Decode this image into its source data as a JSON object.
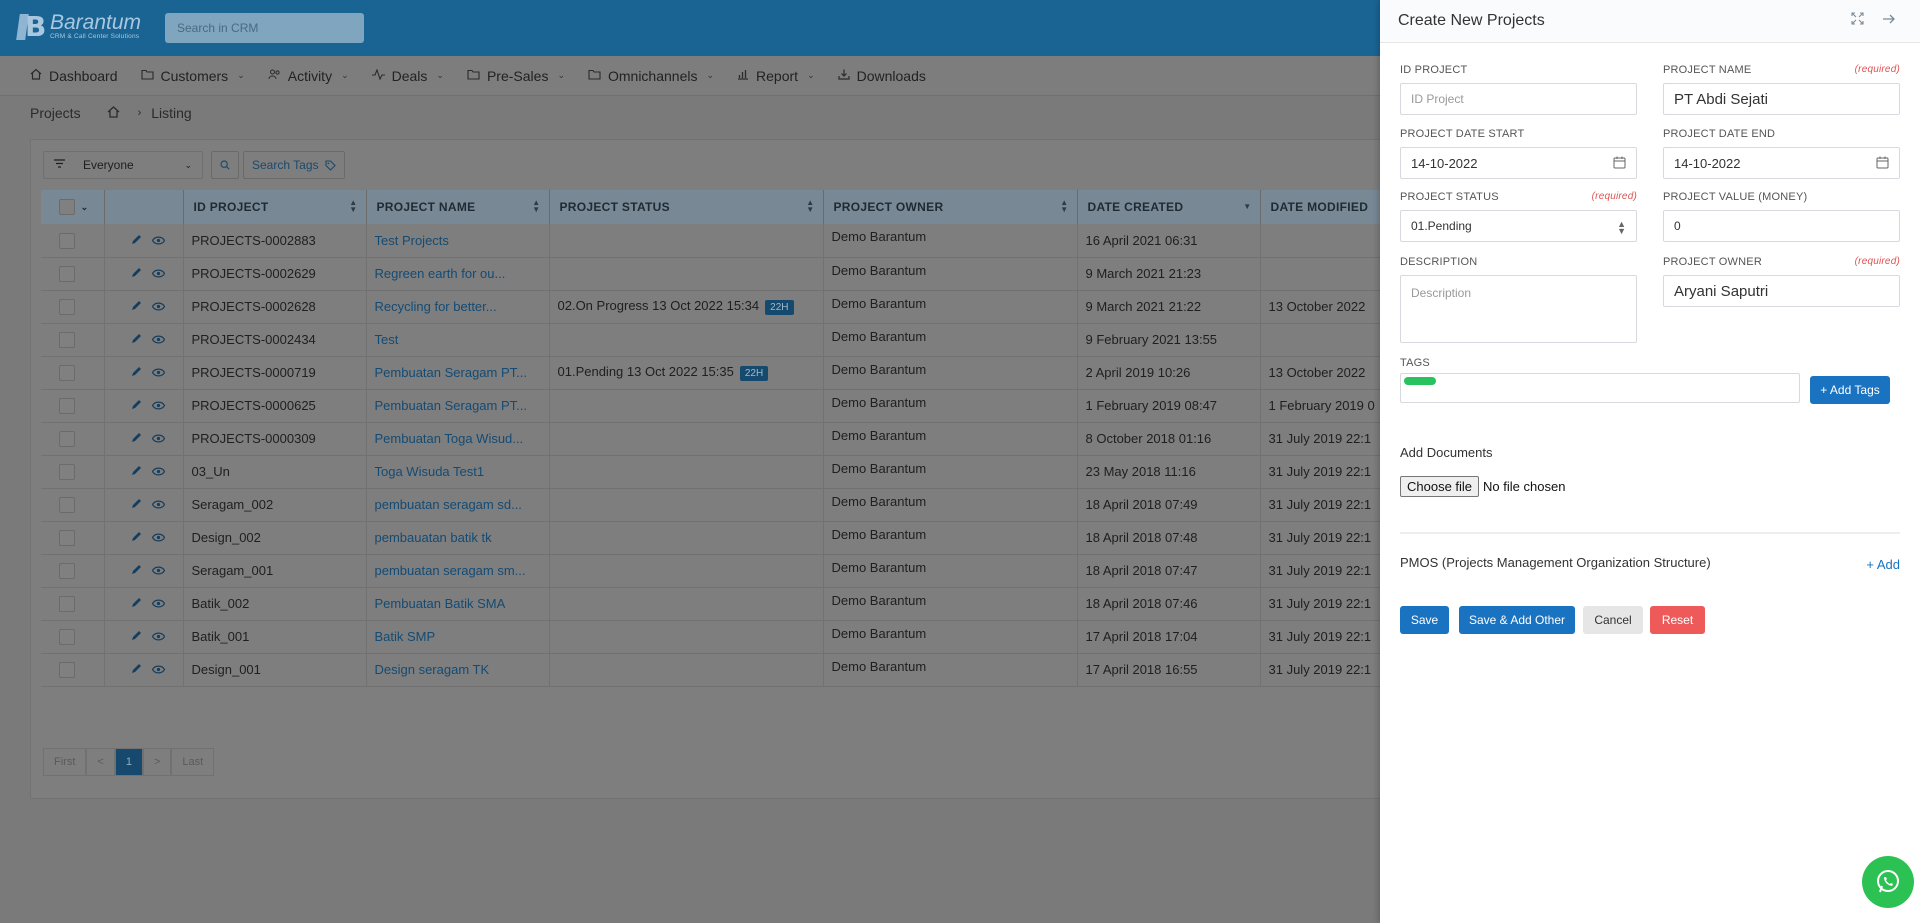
{
  "app": {
    "logo_name": "Barantum",
    "logo_sub": "CRM & Call Center Solutions",
    "search_placeholder": "Search in CRM"
  },
  "nav": [
    {
      "label": "Dashboard",
      "icon": "home-icon",
      "has_dropdown": false
    },
    {
      "label": "Customers",
      "icon": "folder-icon",
      "has_dropdown": true
    },
    {
      "label": "Activity",
      "icon": "people-icon",
      "has_dropdown": true
    },
    {
      "label": "Deals",
      "icon": "pulse-icon",
      "has_dropdown": true
    },
    {
      "label": "Pre-Sales",
      "icon": "folder-icon",
      "has_dropdown": true
    },
    {
      "label": "Omnichannels",
      "icon": "folder-icon",
      "has_dropdown": true
    },
    {
      "label": "Report",
      "icon": "bar-chart-icon",
      "has_dropdown": true
    },
    {
      "label": "Downloads",
      "icon": "download-icon",
      "has_dropdown": false
    }
  ],
  "breadcrumb": {
    "section": "Projects",
    "page": "Listing"
  },
  "filter": {
    "owner_select": "Everyone",
    "search_tags_label": "Search Tags"
  },
  "table": {
    "columns": [
      "ID PROJECT",
      "PROJECT NAME",
      "PROJECT STATUS",
      "PROJECT OWNER",
      "DATE CREATED",
      "DATE MODIFIED"
    ],
    "rows": [
      {
        "id": "PROJECTS-0002883",
        "name": "Test Projects",
        "status": "",
        "badge": "",
        "owner": "Demo Barantum",
        "created": "16 April 2021 06:31",
        "modified": ""
      },
      {
        "id": "PROJECTS-0002629",
        "name": "Regreen earth for ou...",
        "status": "",
        "badge": "",
        "owner": "Demo Barantum",
        "created": "9 March 2021 21:23",
        "modified": ""
      },
      {
        "id": "PROJECTS-0002628",
        "name": "Recycling for better...",
        "status": "02.On Progress 13 Oct 2022 15:34",
        "badge": "22H",
        "owner": "Demo Barantum",
        "created": "9 March 2021 21:22",
        "modified": "13 October 2022"
      },
      {
        "id": "PROJECTS-0002434",
        "name": "Test",
        "status": "",
        "badge": "",
        "owner": "Demo Barantum",
        "created": "9 February 2021 13:55",
        "modified": ""
      },
      {
        "id": "PROJECTS-0000719",
        "name": "Pembuatan Seragam PT...",
        "status": "01.Pending 13 Oct 2022 15:35",
        "badge": "22H",
        "owner": "Demo Barantum",
        "created": "2 April 2019 10:26",
        "modified": "13 October 2022"
      },
      {
        "id": "PROJECTS-0000625",
        "name": "Pembuatan Seragam PT...",
        "status": "",
        "badge": "",
        "owner": "Demo Barantum",
        "created": "1 February 2019 08:47",
        "modified": "1 February 2019 0"
      },
      {
        "id": "PROJECTS-0000309",
        "name": "Pembuatan Toga Wisud...",
        "status": "",
        "badge": "",
        "owner": "Demo Barantum",
        "created": "8 October 2018 01:16",
        "modified": "31 July 2019 22:1"
      },
      {
        "id": "03_Un",
        "name": "Toga Wisuda Test1",
        "status": "",
        "badge": "",
        "owner": "Demo Barantum",
        "created": "23 May 2018 11:16",
        "modified": "31 July 2019 22:1"
      },
      {
        "id": "Seragam_002",
        "name": "pembuatan seragam sd...",
        "status": "",
        "badge": "",
        "owner": "Demo Barantum",
        "created": "18 April 2018 07:49",
        "modified": "31 July 2019 22:1"
      },
      {
        "id": "Design_002",
        "name": "pembauatan batik tk",
        "status": "",
        "badge": "",
        "owner": "Demo Barantum",
        "created": "18 April 2018 07:48",
        "modified": "31 July 2019 22:1"
      },
      {
        "id": "Seragam_001",
        "name": "pembuatan seragam sm...",
        "status": "",
        "badge": "",
        "owner": "Demo Barantum",
        "created": "18 April 2018 07:47",
        "modified": "31 July 2019 22:1"
      },
      {
        "id": "Batik_002",
        "name": "Pembuatan Batik SMA",
        "status": "",
        "badge": "",
        "owner": "Demo Barantum",
        "created": "18 April 2018 07:46",
        "modified": "31 July 2019 22:1"
      },
      {
        "id": "Batik_001",
        "name": "Batik SMP",
        "status": "",
        "badge": "",
        "owner": "Demo Barantum",
        "created": "17 April 2018 17:04",
        "modified": "31 July 2019 22:1"
      },
      {
        "id": "Design_001",
        "name": "Design seragam TK",
        "status": "",
        "badge": "",
        "owner": "Demo Barantum",
        "created": "17 April 2018 16:55",
        "modified": "31 July 2019 22:1"
      }
    ]
  },
  "pager": {
    "first": "First",
    "prev": "<",
    "current": "1",
    "next": ">",
    "last": "Last"
  },
  "drawer": {
    "title": "Create New Projects",
    "required_text": "(required)",
    "id_label": "ID PROJECT",
    "id_placeholder": "ID Project",
    "name_label": "PROJECT NAME",
    "name_value": "PT Abdi Sejati",
    "start_label": "PROJECT DATE START",
    "start_value": "14-10-2022",
    "end_label": "PROJECT DATE END",
    "end_value": "14-10-2022",
    "status_label": "PROJECT STATUS",
    "status_value": "01.Pending",
    "value_label": "PROJECT VALUE (MONEY)",
    "value_value": "0",
    "desc_label": "DESCRIPTION",
    "desc_placeholder": "Description",
    "owner_label": "PROJECT OWNER",
    "owner_value": "Aryani Saputri",
    "tags_label": "TAGS",
    "add_tags": "+ Add Tags",
    "docs_label": "Add Documents",
    "choose_file": "Choose file",
    "no_file": "No file chosen",
    "pmos_label": "PMOS (Projects Management Organization Structure)",
    "pmos_add": "+ Add",
    "save": "Save",
    "save_add": "Save & Add Other",
    "cancel": "Cancel",
    "reset": "Reset"
  },
  "colors": {
    "primary": "#1a73c0",
    "danger": "#ee5a5a",
    "topbar": "#1a6494",
    "tag_green": "#28c35e",
    "whatsapp": "#2bc253"
  }
}
